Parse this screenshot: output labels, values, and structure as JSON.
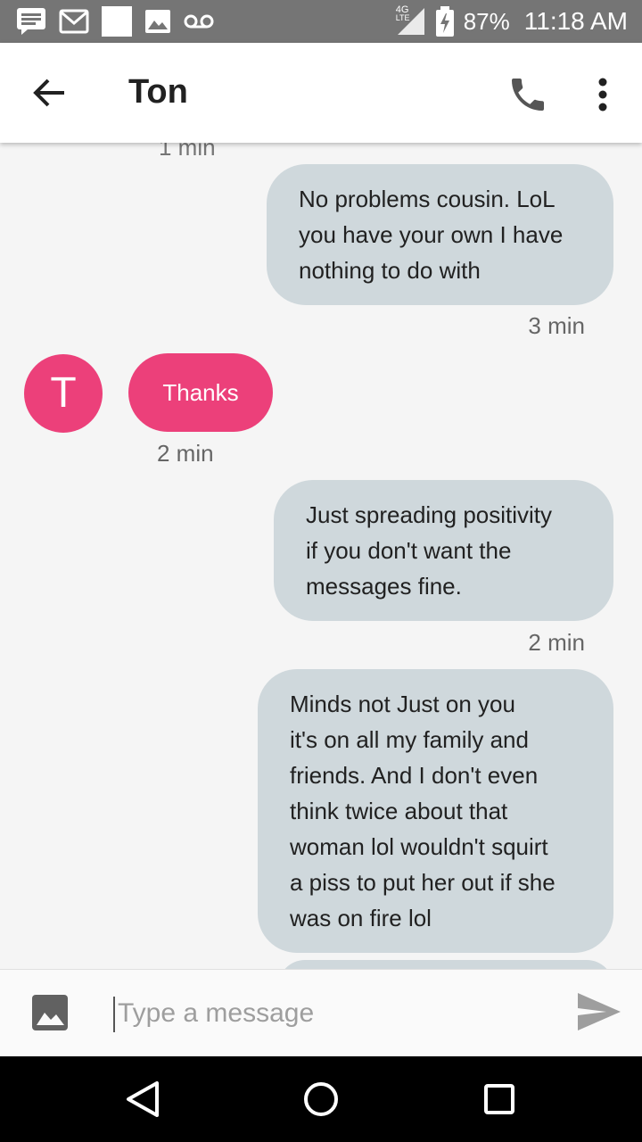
{
  "status_bar": {
    "network": "4G",
    "network_sub": "LTE",
    "battery": "87%",
    "time": "11:18 AM"
  },
  "header": {
    "title": "Ton"
  },
  "conversation": {
    "cut_timestamp": "1 min",
    "messages": [
      {
        "sender": "me",
        "lines": [
          "No problems cousin. LoL",
          "you have your own I have",
          "nothing to do with"
        ],
        "time": "3 min"
      },
      {
        "sender": "contact",
        "avatar_letter": "T",
        "text": "Thanks",
        "time": "2 min"
      },
      {
        "sender": "me",
        "lines": [
          "Just spreading positivity",
          "if you don't want the",
          "messages fine."
        ],
        "time": "2 min"
      },
      {
        "sender": "me",
        "lines": [
          "Minds not Just on you",
          "it's on all my family and",
          "friends. And I don't even",
          "think twice about that",
          "woman lol wouldn't squirt",
          "a piss to put her out if she",
          "was on fire lol"
        ]
      }
    ]
  },
  "compose": {
    "placeholder": "Type a message"
  },
  "colors": {
    "status_bar": "#757575",
    "outgoing_bubble": "#cfd8dc",
    "incoming_bubble": "#ec407a",
    "avatar": "#ec407a"
  },
  "icons": {
    "back": "arrow-left-icon",
    "call": "phone-icon",
    "menu": "more-vertical-icon",
    "attach": "image-icon",
    "send": "send-icon"
  }
}
